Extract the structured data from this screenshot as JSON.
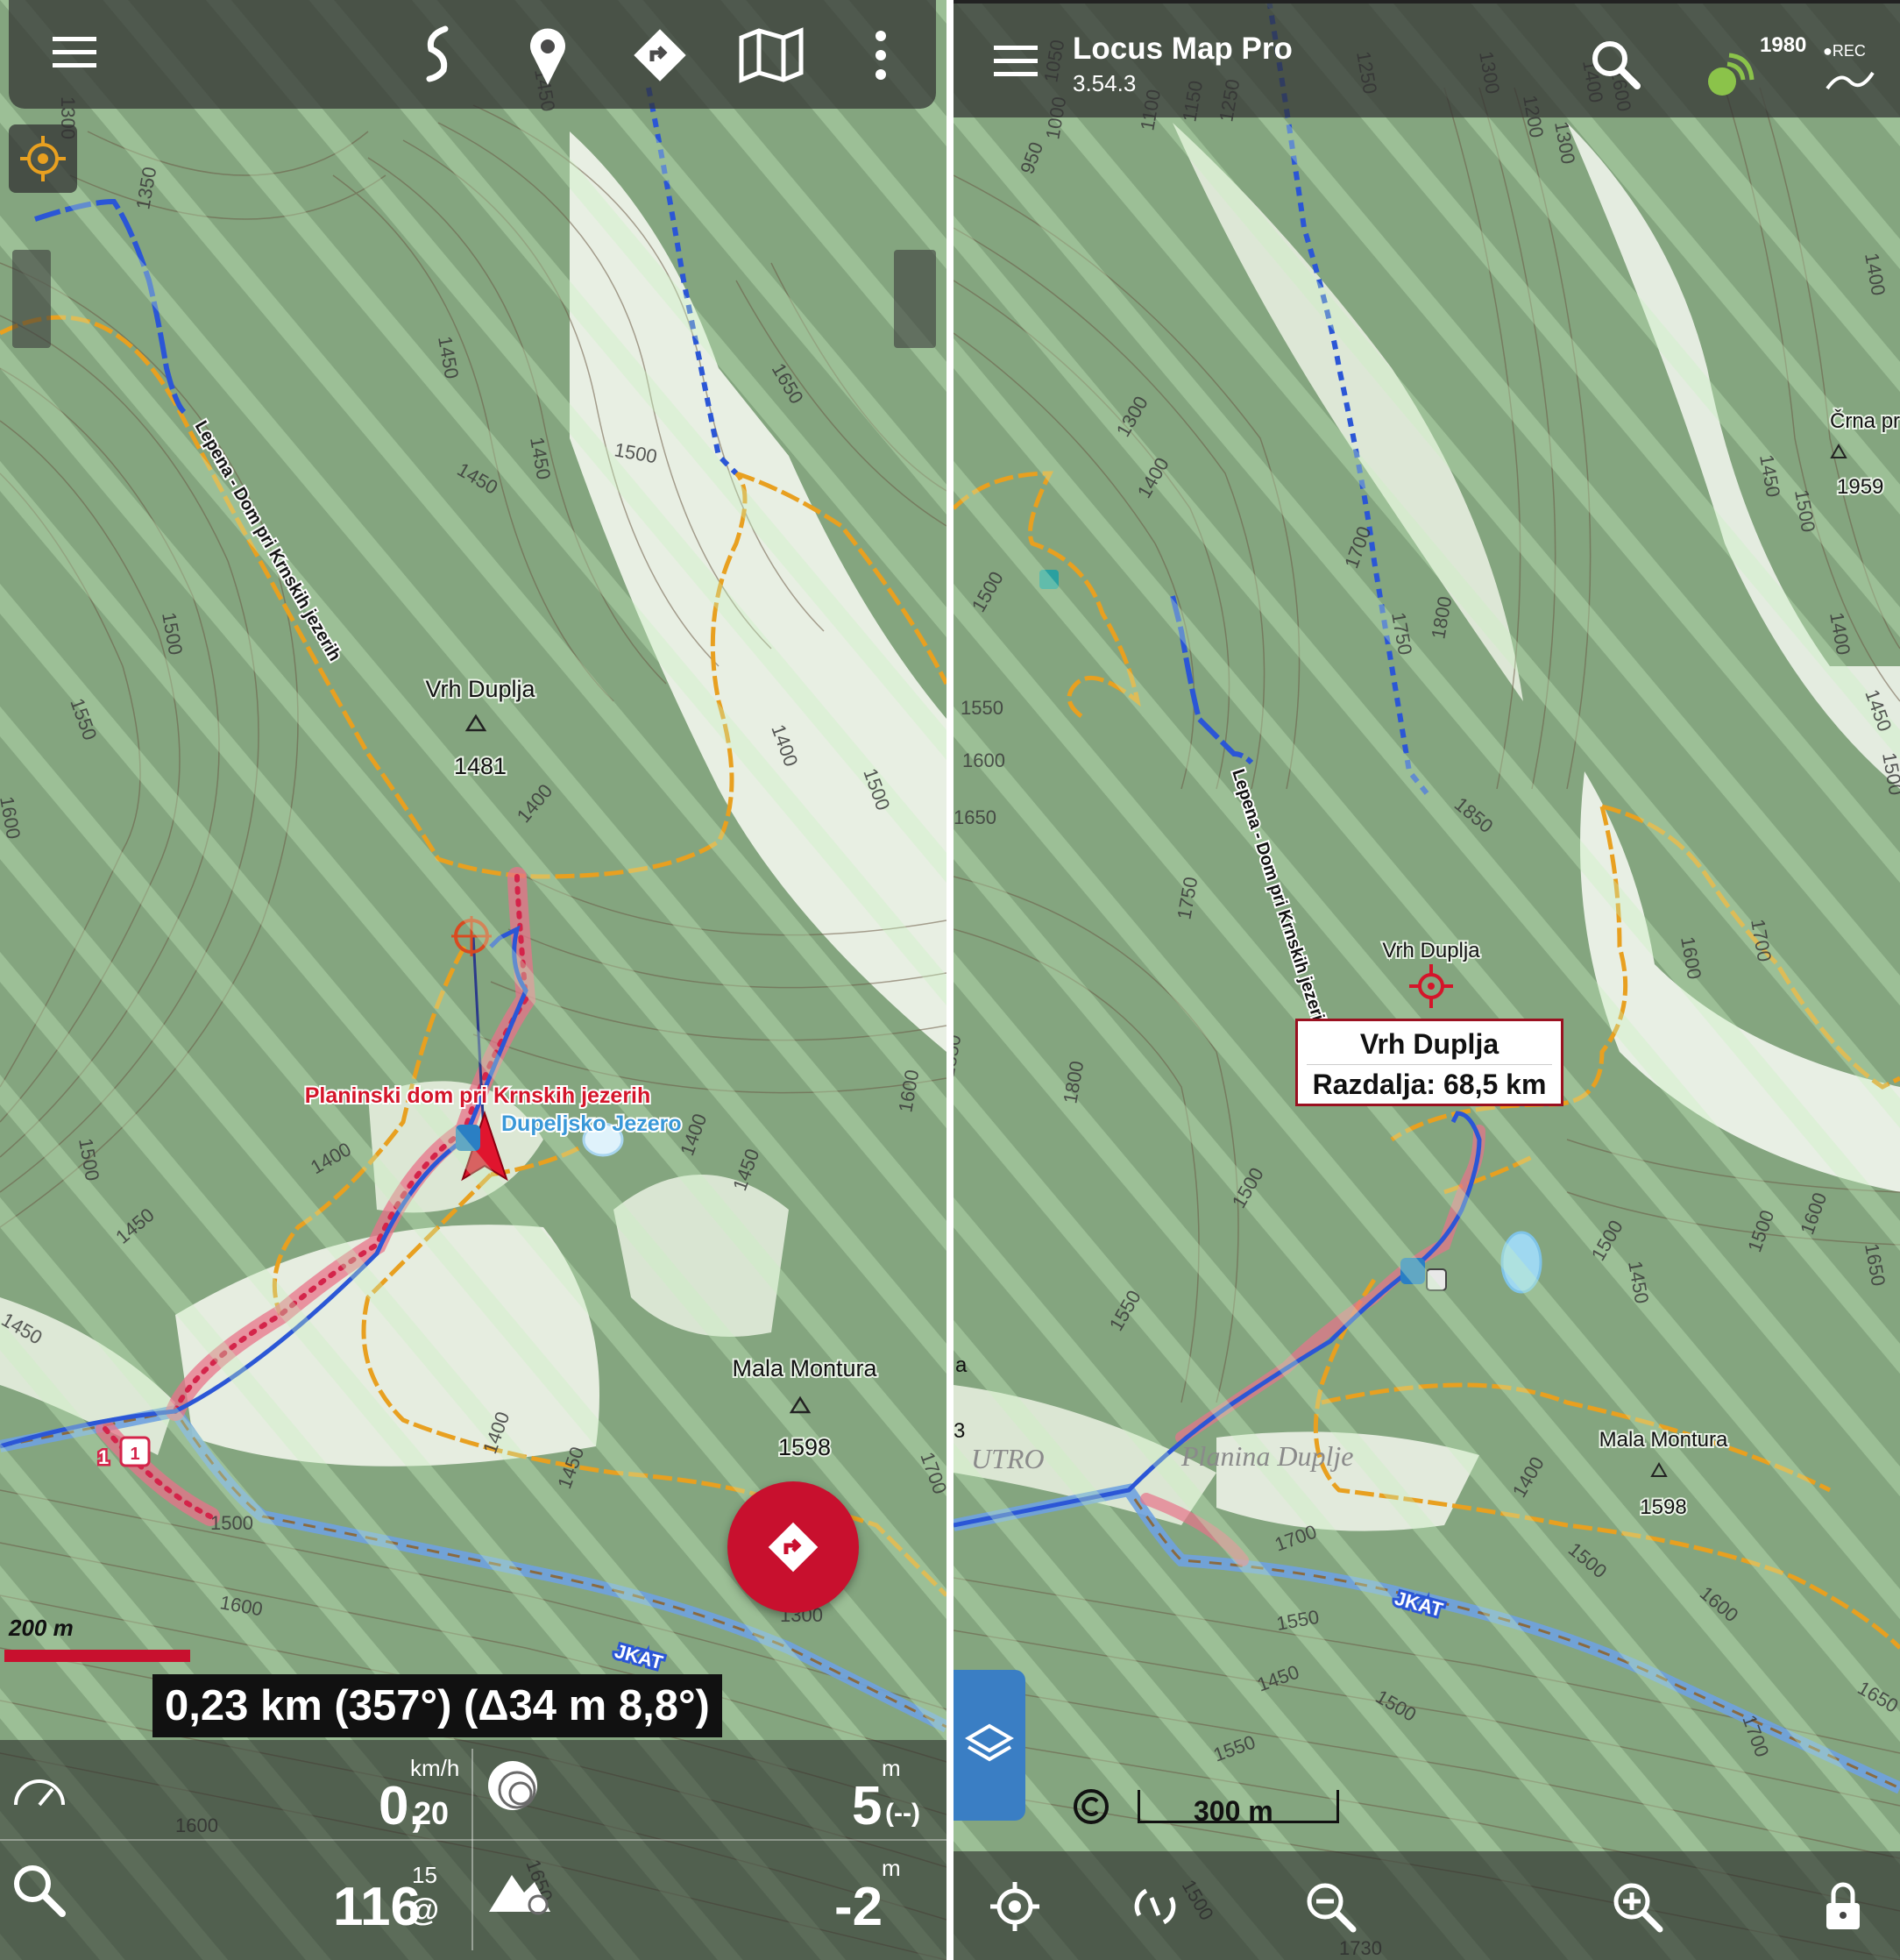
{
  "left": {
    "toolbar_icons": [
      "menu-icon",
      "route-icon",
      "poi-icon",
      "navigation-icon",
      "map-icon",
      "more-icon"
    ],
    "map_labels": {
      "trail_name": "Lepena - Dom pri Krnskih jezerih",
      "peak1_name": "Vrh Duplja",
      "peak1_elev": "1481",
      "hut_name": "Planinski dom pri Krnskih jezerih",
      "lake_name": "Dupeljsko Jezero",
      "peak2_name": "Mala Montura",
      "peak2_elev": "1598",
      "road_label": "JKAT",
      "trail_marker_1": "1",
      "trail_marker_2": "1"
    },
    "contours": [
      "1300",
      "1350",
      "1450",
      "1450",
      "1500",
      "1550",
      "1600",
      "1650",
      "1500",
      "1450",
      "1450",
      "1400",
      "1500",
      "1600",
      "1400",
      "1450",
      "1500",
      "1450",
      "1400",
      "1400",
      "1450",
      "1400",
      "1450",
      "1500",
      "1600",
      "1300",
      "1600",
      "1650",
      "1700"
    ],
    "scale": "200 m",
    "distance_readout": "0,23 km (357°) (Δ34 m 8,8°)",
    "stats": {
      "speed_value": "0,",
      "speed_decimal": "20",
      "speed_unit": "km/h",
      "accuracy_value": "5",
      "accuracy_sub": "(--)",
      "accuracy_unit": "m",
      "altitude_value": "116",
      "altitude_sub": "@",
      "altitude_sup": "15",
      "elev_diff_value": "-2",
      "elev_diff_unit": "m"
    }
  },
  "right": {
    "app_title": "Locus Map Pro",
    "app_version": "3.54.3",
    "gps_count": "1980",
    "rec_label": "●REC",
    "map_labels": {
      "trail_name": "Lepena - Dom pri Krnskih jezerih",
      "peak1_name": "Vrh Duplja",
      "peak_far_name": "Črna pr",
      "peak_far_elev": "1959",
      "peak2_name": "Mala Montura",
      "peak2_elev": "1598",
      "area1": "UTRO",
      "area2": "Planina Duplje",
      "road_label": "JKAT",
      "edge_a": "a",
      "edge_3": "3"
    },
    "popup": {
      "title": "Vrh Duplja",
      "distance": "Razdalja: 68,5 km"
    },
    "contours": [
      "950",
      "1000",
      "1050",
      "1100",
      "1150",
      "1250",
      "1300",
      "1400",
      "1500",
      "1550",
      "1600",
      "1650",
      "1700",
      "1750",
      "1800",
      "1850",
      "1250",
      "1300",
      "1200",
      "1300",
      "1400",
      "1600",
      "1400",
      "1450",
      "1500",
      "1400",
      "1450",
      "1500",
      "1600",
      "1700",
      "1750",
      "1800",
      "1850",
      "1500",
      "1550",
      "1500",
      "1450",
      "1500",
      "1600",
      "1650",
      "1700",
      "1400",
      "1500",
      "1550",
      "1450",
      "1500",
      "1550",
      "1600",
      "1650",
      "1700",
      "1500",
      "1730"
    ],
    "scale": "300 m",
    "bottom_icons": [
      "gps-center-icon",
      "rotate-icon",
      "zoom-out-icon",
      "zoom-in-icon",
      "lock-icon"
    ]
  }
}
